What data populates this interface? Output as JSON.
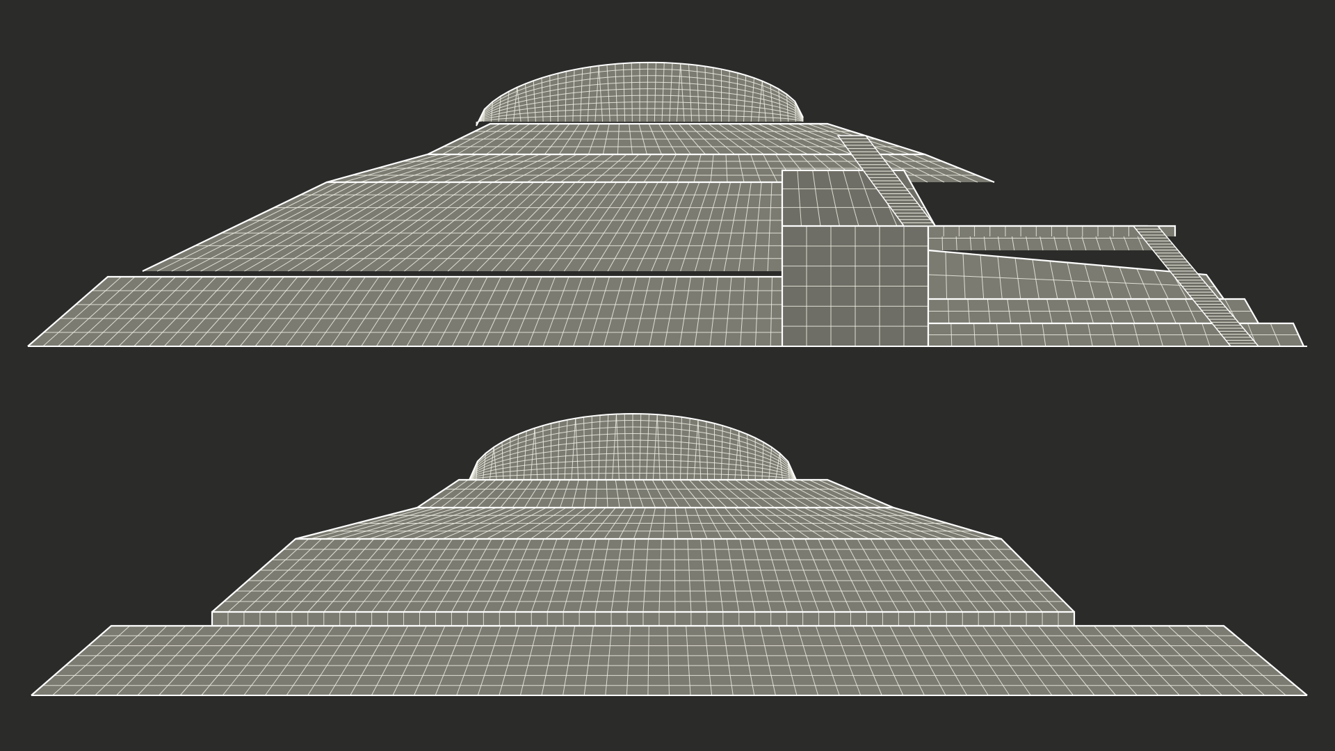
{
  "scene": {
    "subject": "stepped-pyramid-wireframe",
    "views": [
      {
        "id": "side-view"
      },
      {
        "id": "front-view"
      }
    ]
  },
  "colors": {
    "background": "#2b2b2a",
    "surface": "#7b7b72",
    "surface_shade": "#6e6e66",
    "wire": "#f2f1e6",
    "terrace_edge": "#ffffff"
  }
}
